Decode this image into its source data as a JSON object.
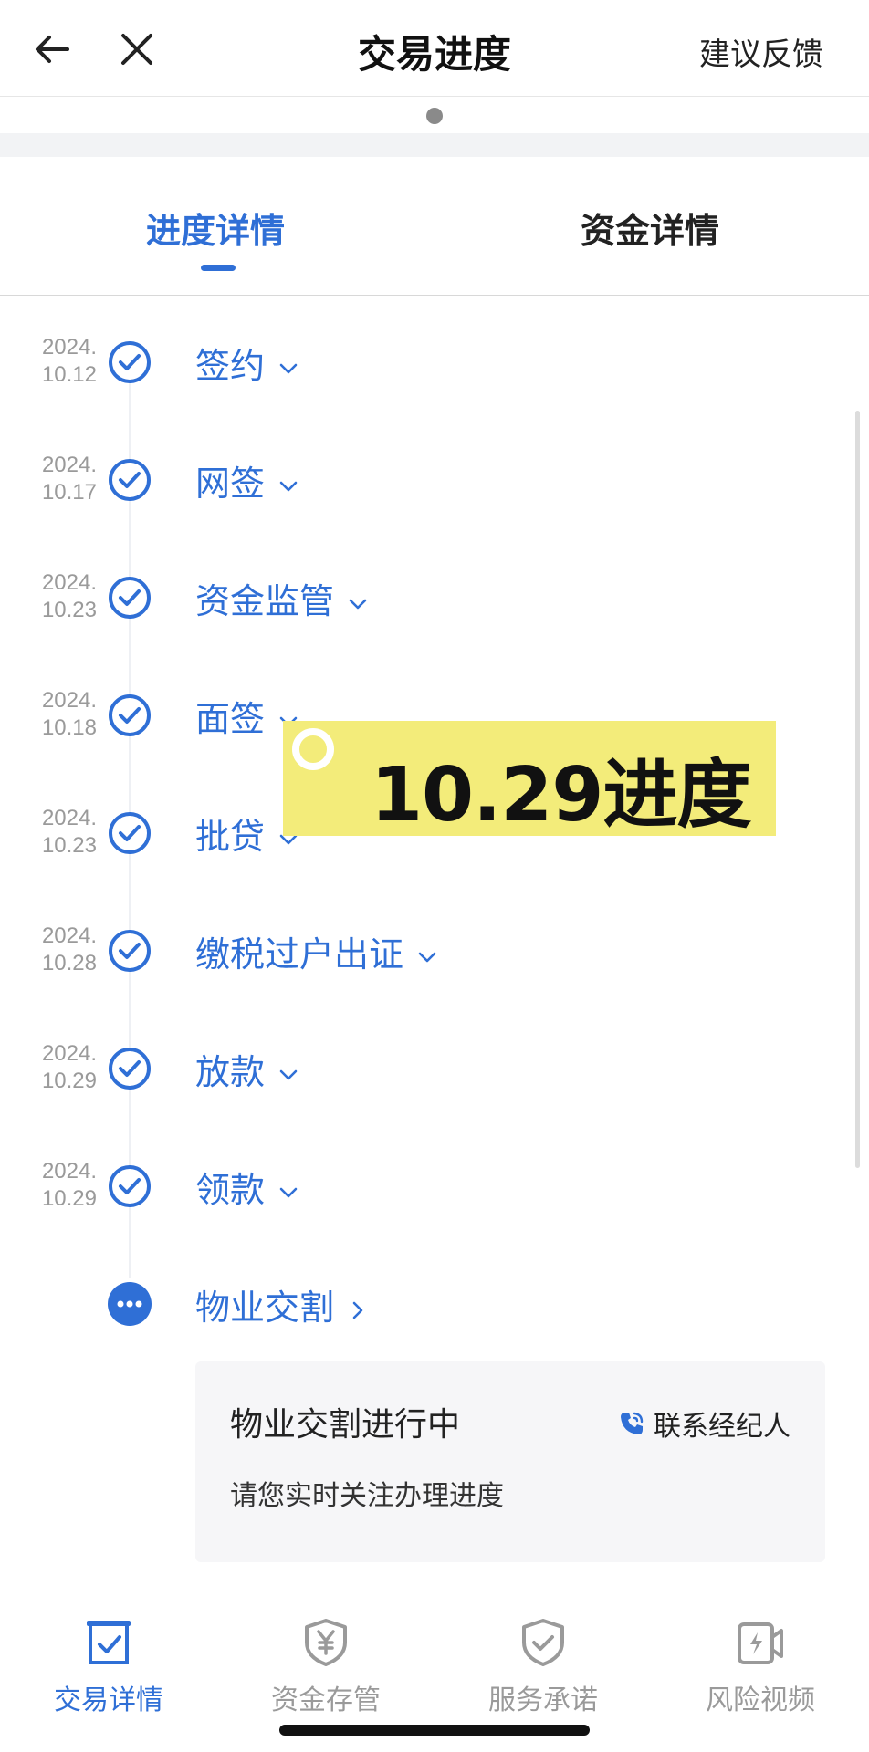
{
  "header": {
    "title": "交易进度",
    "feedback": "建议反馈",
    "back_icon": "arrow-left-icon",
    "close_icon": "close-icon"
  },
  "tabs": [
    {
      "label": "进度详情",
      "active": true
    },
    {
      "label": "资金详情",
      "active": false
    }
  ],
  "steps": [
    {
      "date_year": "2024.",
      "date_day": "10.12",
      "label": "签约",
      "status": "done",
      "chevron": "down"
    },
    {
      "date_year": "2024.",
      "date_day": "10.17",
      "label": "网签",
      "status": "done",
      "chevron": "down"
    },
    {
      "date_year": "2024.",
      "date_day": "10.23",
      "label": "资金监管",
      "status": "done",
      "chevron": "down"
    },
    {
      "date_year": "2024.",
      "date_day": "10.18",
      "label": "面签",
      "status": "done",
      "chevron": "down"
    },
    {
      "date_year": "2024.",
      "date_day": "10.23",
      "label": "批贷",
      "status": "done",
      "chevron": "down"
    },
    {
      "date_year": "2024.",
      "date_day": "10.28",
      "label": "缴税过户出证",
      "status": "done",
      "chevron": "down"
    },
    {
      "date_year": "2024.",
      "date_day": "10.29",
      "label": "放款",
      "status": "done",
      "chevron": "down"
    },
    {
      "date_year": "2024.",
      "date_day": "10.29",
      "label": "领款",
      "status": "done",
      "chevron": "down"
    },
    {
      "date_year": "",
      "date_day": "",
      "label": "物业交割",
      "status": "in-progress",
      "chevron": "right"
    }
  ],
  "sticker": {
    "text": "10.29进度"
  },
  "card": {
    "title": "物业交割进行中",
    "contact": "联系经纪人",
    "subtitle": "请您实时关注办理进度"
  },
  "bottom_nav": [
    {
      "label": "交易详情",
      "icon": "doc-check-icon",
      "active": true
    },
    {
      "label": "资金存管",
      "icon": "shield-yen-icon",
      "active": false
    },
    {
      "label": "服务承诺",
      "icon": "shield-check-icon",
      "active": false
    },
    {
      "label": "风险视频",
      "icon": "video-icon",
      "active": false
    }
  ],
  "colors": {
    "accent": "#2f6fd6",
    "sticker": "#f3ec7a",
    "muted": "#9a9a9a"
  }
}
